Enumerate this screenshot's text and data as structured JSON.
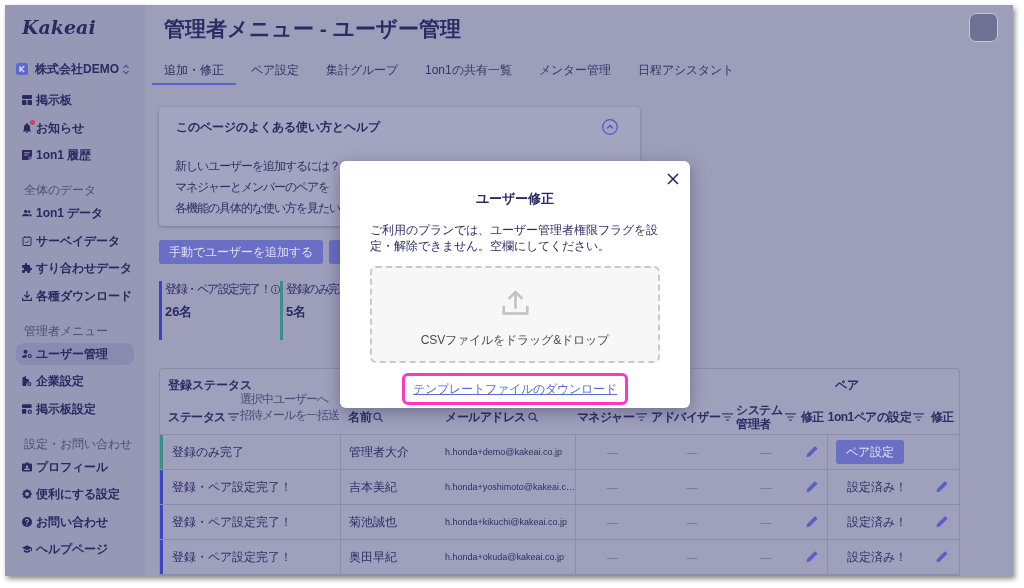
{
  "sidebar": {
    "logo": "Kakeai",
    "workspace": "株式会社DEMO",
    "sections": [
      {
        "items": [
          {
            "label": "掲示板",
            "selected": false,
            "notify": false
          },
          {
            "label": "お知らせ",
            "selected": false,
            "notify": true
          },
          {
            "label": "1on1 履歴",
            "selected": false,
            "notify": false
          }
        ]
      },
      {
        "heading": "全体のデータ",
        "items": [
          {
            "label": "1on1 データ",
            "selected": false,
            "notify": false
          },
          {
            "label": "サーベイデータ",
            "selected": false,
            "notify": false
          },
          {
            "label": "すり合わせデータ",
            "selected": false,
            "notify": false
          },
          {
            "label": "各種ダウンロード",
            "selected": false,
            "notify": false
          }
        ]
      },
      {
        "heading": "管理者メニュー",
        "items": [
          {
            "label": "ユーザー管理",
            "selected": true,
            "notify": false
          },
          {
            "label": "企業設定",
            "selected": false,
            "notify": false
          },
          {
            "label": "掲示板設定",
            "selected": false,
            "notify": false
          }
        ]
      },
      {
        "heading": "設定・お問い合わせ",
        "items": [
          {
            "label": "プロフィール",
            "selected": false,
            "notify": false
          },
          {
            "label": "便利にする設定",
            "selected": false,
            "notify": false
          },
          {
            "label": "お問い合わせ",
            "selected": false,
            "notify": false
          },
          {
            "label": "ヘルプページ",
            "selected": false,
            "notify": false
          }
        ]
      }
    ]
  },
  "page": {
    "title": "管理者メニュー - ユーザー管理"
  },
  "tabs": [
    {
      "label": "追加・修正",
      "selected": true
    },
    {
      "label": "ペア設定",
      "selected": false
    },
    {
      "label": "集計グループ",
      "selected": false
    },
    {
      "label": "1on1の共有一覧",
      "selected": false
    },
    {
      "label": "メンター管理",
      "selected": false
    },
    {
      "label": "日程アシスタント",
      "selected": false
    }
  ],
  "help": {
    "title": "このページのよくある使い方とヘルプ",
    "expanded": true,
    "items": [
      "新しいユーザーを追加するには？",
      "マネジャーとメンバーのペアを",
      "各機能の具体的な使い方を見たい"
    ]
  },
  "actions": [
    {
      "label": "手動でユーザーを追加する"
    }
  ],
  "stats": [
    {
      "label": "登録・ペア設定完了！",
      "value": "26名",
      "color": "#3d44c3",
      "info": true
    },
    {
      "label": "登録のみ完",
      "value": "5名",
      "color": "#3c8e8a",
      "info": false
    }
  ],
  "table": {
    "groups": [
      {
        "label": "登録ステータス"
      },
      {
        "label": "ペア"
      }
    ],
    "columns": [
      {
        "label": "ステータス",
        "kind": "filter"
      },
      {
        "label": "名前",
        "kind": "search"
      },
      {
        "label": "メールアドレス",
        "kind": "search"
      },
      {
        "label": "マネジャー",
        "kind": "filter"
      },
      {
        "label": "アドバイザー",
        "kind": "filter"
      },
      {
        "label": "システム管理者",
        "kind": "filter"
      },
      {
        "label": "修正",
        "kind": "plain"
      },
      {
        "label": "1on1ペアの設定",
        "kind": "filter"
      },
      {
        "label": "修正",
        "kind": "plain"
      }
    ],
    "bulk_hint": {
      "lines": [
        "選択中ユーザーへ",
        "招待メールを一括送"
      ],
      "disabled": true
    },
    "rows": [
      {
        "status": "登録のみ完了",
        "color": "#3c8e8a",
        "name": "管理者大介",
        "email": "h.honda+demo@kakeai.co.jp",
        "manager": "—",
        "adviser": "—",
        "system_admin": "—",
        "pair": {
          "kind": "button",
          "label": "ペア設定"
        }
      },
      {
        "status": "登録・ペア設定完了！",
        "color": "#3d44c3",
        "name": "吉本美紀",
        "email": "h.honda+yoshimoto@kakeai.c…",
        "manager": "—",
        "adviser": "—",
        "system_admin": "—",
        "pair": {
          "kind": "done",
          "label": "設定済み！"
        }
      },
      {
        "status": "登録・ペア設定完了！",
        "color": "#3d44c3",
        "name": "菊池誠也",
        "email": "h.honda+kikuchi@kakeai.co.jp",
        "manager": "—",
        "adviser": "—",
        "system_admin": "—",
        "pair": {
          "kind": "done",
          "label": "設定済み！"
        }
      },
      {
        "status": "登録・ペア設定完了！",
        "color": "#3d44c3",
        "name": "奥田早紀",
        "email": "h.honda+okuda@kakeai.co.jp",
        "manager": "—",
        "adviser": "—",
        "system_admin": "—",
        "pair": {
          "kind": "done",
          "label": "設定済み！"
        }
      }
    ]
  },
  "modal": {
    "title": "ユーザー修正",
    "message": "ご利用のプランでは、ユーザー管理者権限フラグを設定・解除できません。空欄にしてください。",
    "dropzone": {
      "label": "CSVファイルをドラッグ&ドロップ"
    },
    "template_link": {
      "label": "テンプレートファイルのダウンロード",
      "highlighted": true
    }
  }
}
